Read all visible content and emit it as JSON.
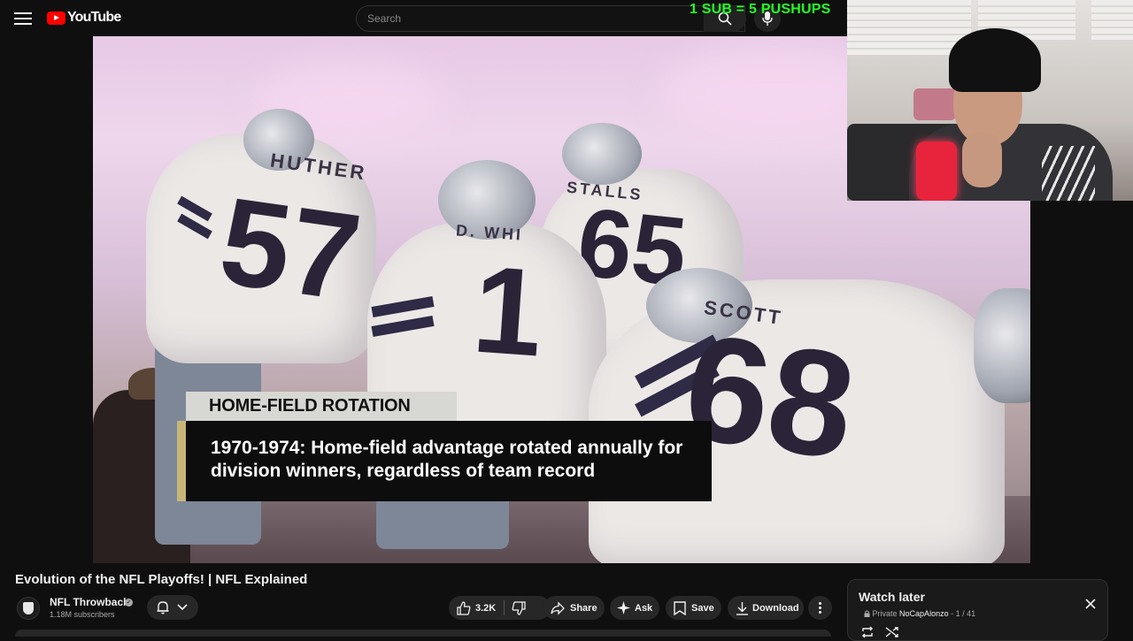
{
  "header": {
    "logo_text": "YouTube",
    "search_placeholder": "Search",
    "overlay_text": "1 SUB = 5 PUSHUPS"
  },
  "video": {
    "lower_third_tag": "HOME-FIELD ROTATION",
    "lower_third_text": "1970-1974: Home-field advantage rotated annually for division winners, regardless of team record",
    "jersey_names": [
      "HUTHER",
      "D. WHI",
      "STALLS",
      "SCOTT"
    ],
    "jersey_numbers": [
      "57",
      "1",
      "65",
      "68"
    ]
  },
  "details": {
    "title": "Evolution of the NFL Playoffs! | NFL Explained",
    "channel_name": "NFL Throwback",
    "subscribers": "1.18M subscribers",
    "like_count": "3.2K",
    "share_label": "Share",
    "ask_label": "Ask",
    "save_label": "Save",
    "download_label": "Download"
  },
  "playlist": {
    "title": "Watch later",
    "privacy": "Private",
    "owner": "NoCapAlonzo",
    "position": "1 / 41"
  },
  "colors": {
    "brand": "#ff0000",
    "overlay_green": "#22ff22",
    "background": "#0f0f0f"
  },
  "icons": [
    "menu-icon",
    "search-icon",
    "mic-icon",
    "bell-icon",
    "chevron-down-icon",
    "like-icon",
    "dislike-icon",
    "share-icon",
    "ask-icon",
    "save-icon",
    "download-icon",
    "more-icon",
    "lock-icon",
    "close-icon",
    "loop-icon",
    "shuffle-icon",
    "verified-icon"
  ]
}
